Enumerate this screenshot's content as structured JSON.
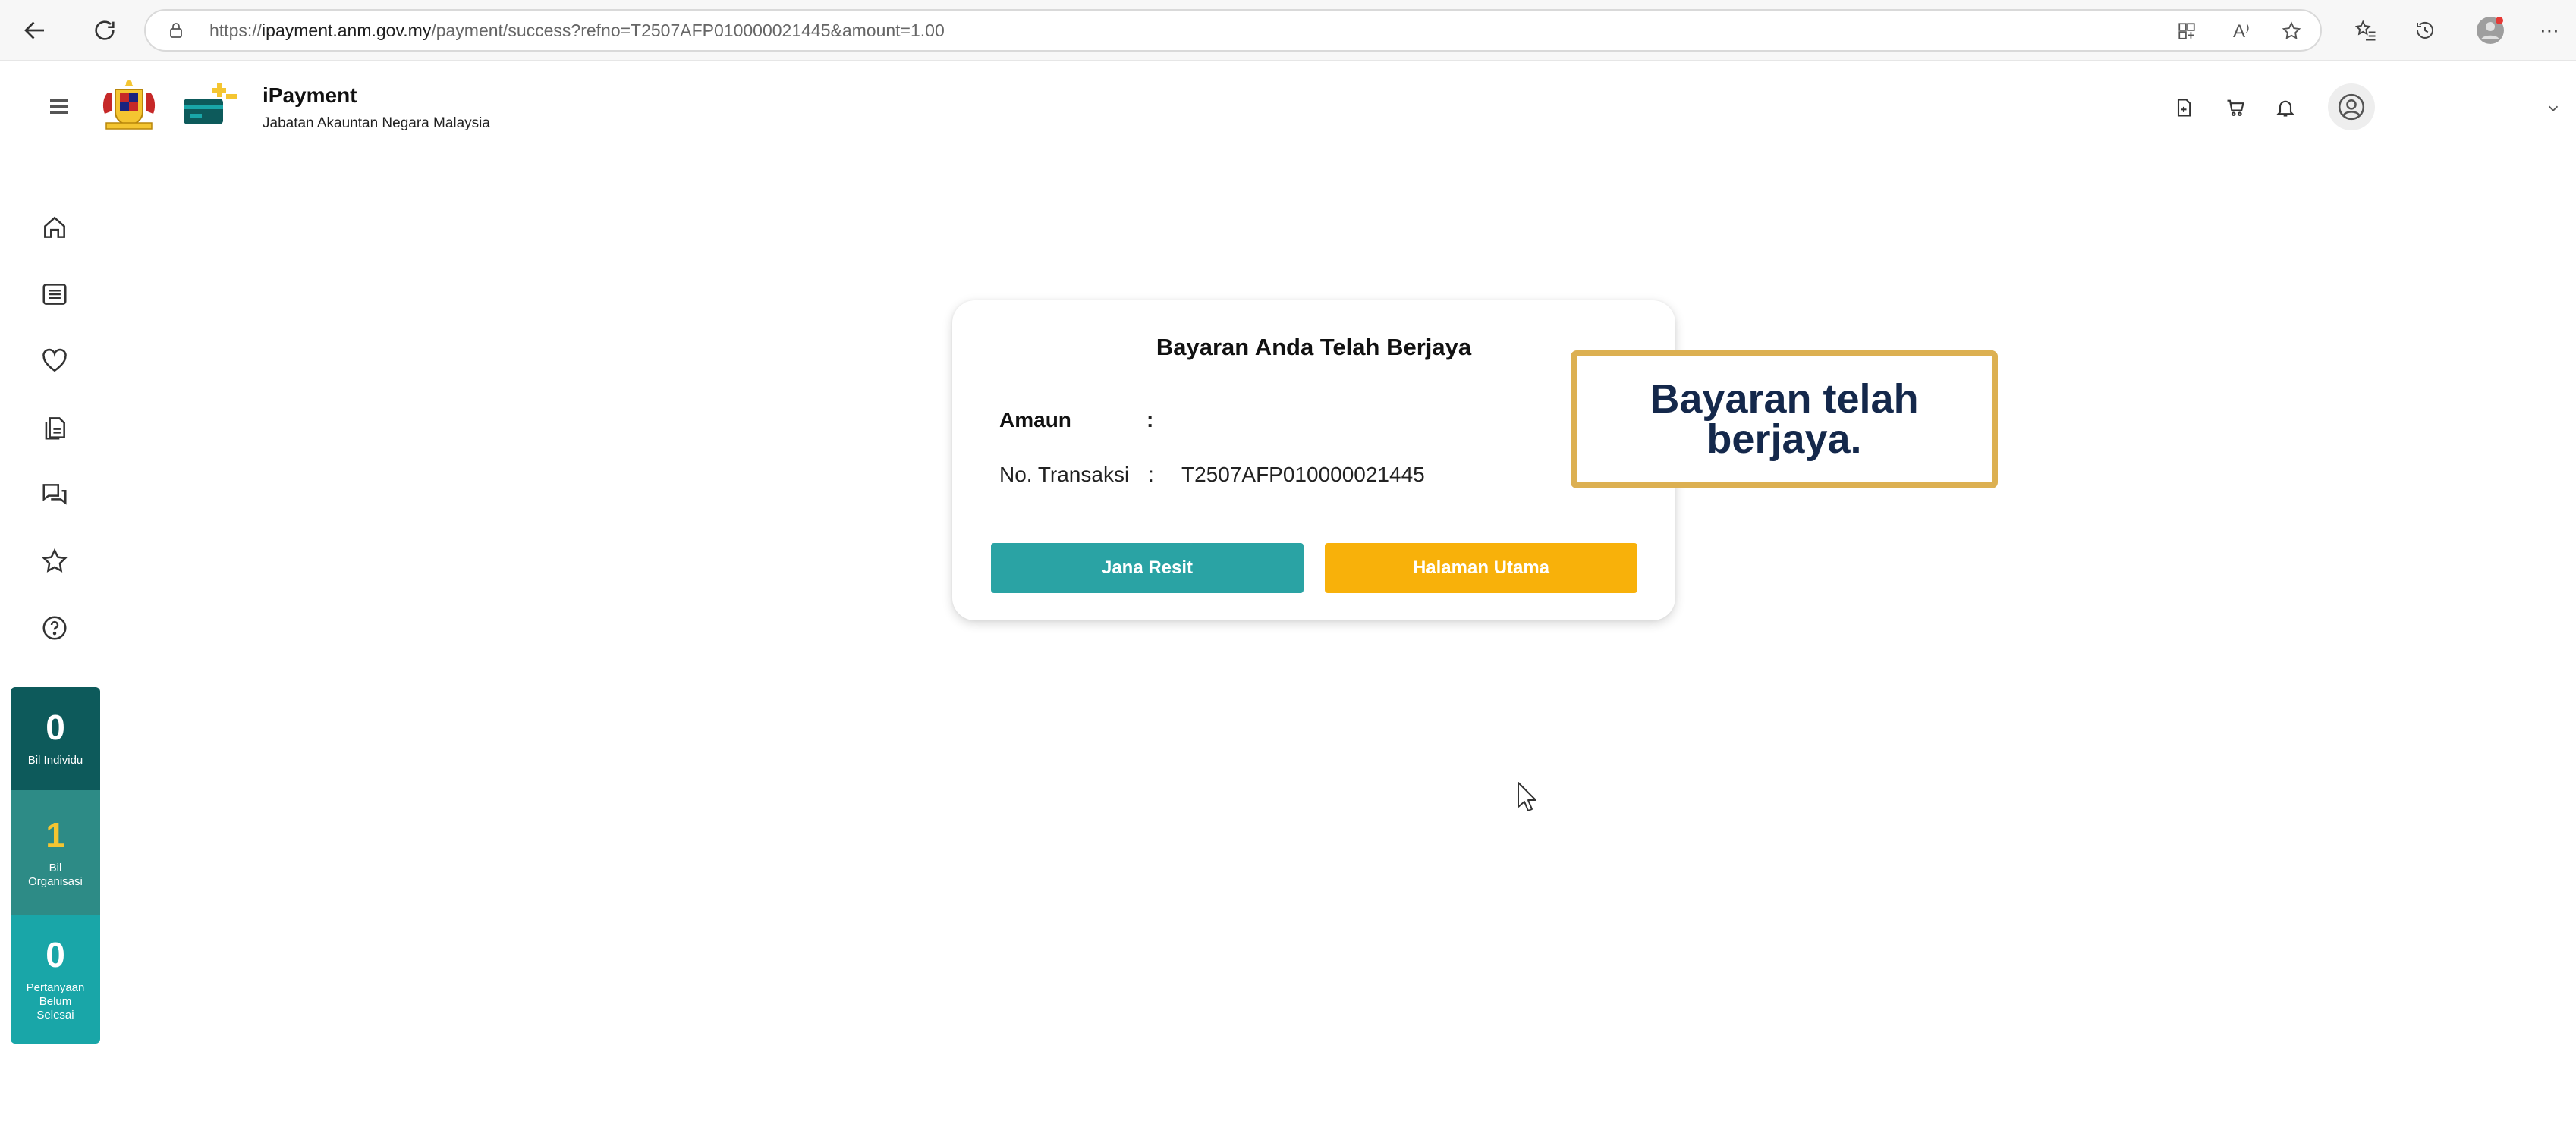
{
  "browser": {
    "url_prefix": "https://",
    "url_host": "ipayment.anm.gov.my",
    "url_path": "/payment/success?refno=T2507AFP010000021445&amount=1.00",
    "read_aloud_label": "A⁾",
    "more_label": "⋯"
  },
  "app": {
    "title": "iPayment",
    "subtitle": "Jabatan Akauntan Negara Malaysia"
  },
  "sidebar": {
    "icons": [
      "home-icon",
      "list-icon",
      "heart-icon",
      "document-icon",
      "chat-icon",
      "star-icon",
      "help-icon"
    ],
    "stats": [
      {
        "value": "0",
        "label": "Bil Individu"
      },
      {
        "value": "1",
        "label": "Bil Organisasi"
      },
      {
        "value": "0",
        "label": "Pertanyaan Belum Selesai"
      }
    ]
  },
  "card": {
    "title": "Bayaran Anda Telah Berjaya",
    "amount_label": "Amaun",
    "amount_colon": ":",
    "amount_value": "",
    "transaction_label": "No. Transaksi",
    "transaction_colon": ":",
    "transaction_value": "T2507AFP010000021445",
    "receipt_button": "Jana Resit",
    "home_button": "Halaman Utama"
  },
  "callout": {
    "text": "Bayaran telah berjaya."
  },
  "colors": {
    "teal_button": "#2aa3a4",
    "orange_button": "#f8b10a",
    "callout_border": "#dcb052",
    "callout_text": "#14284b",
    "stat_dark": "#0d5a5b",
    "stat_mid": "#2d8b86",
    "stat_light": "#19a6a8",
    "stat_highlight": "#f4c531"
  }
}
